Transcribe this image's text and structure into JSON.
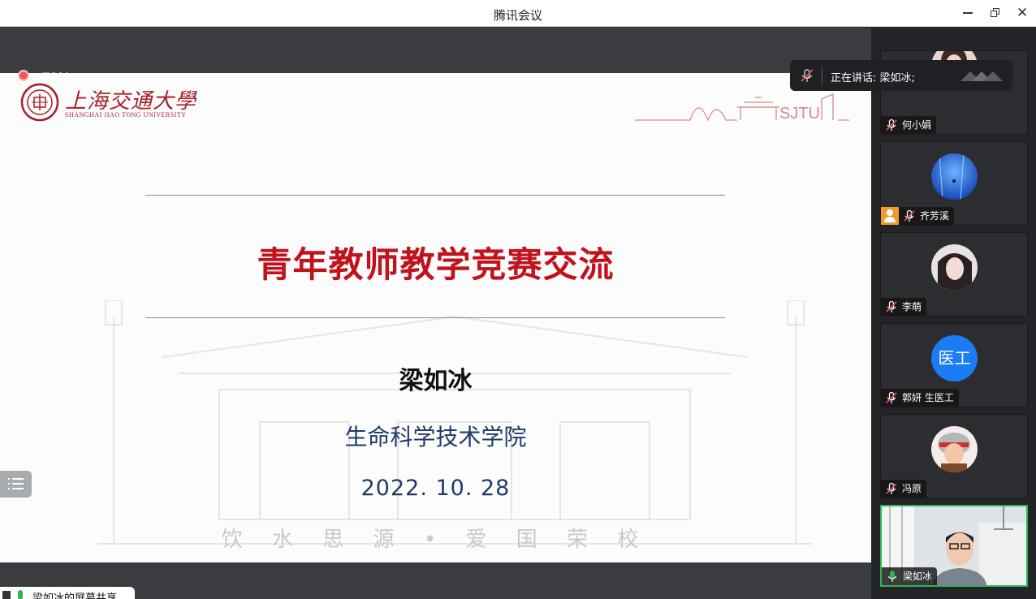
{
  "window": {
    "title": "腾讯会议"
  },
  "recording": {
    "label": "录制中"
  },
  "slide": {
    "university_cn": "上海交通大學",
    "university_en": "SHANGHAI JIAO TONG UNIVERSITY",
    "deco_text": "SJTU",
    "title": "青年教师教学竞赛交流",
    "presenter": "梁如冰",
    "school": "生命科学技术学院",
    "date": "2022. 10. 28",
    "motto": "饮 水 思 源 • 爱 国 荣 校"
  },
  "speaking_banner": {
    "text": "正在讲话: 梁如冰;"
  },
  "share_chip": {
    "text": "梁如冰的屏幕共享"
  },
  "participants": [
    {
      "name": "何小娟",
      "avatar": "photo",
      "mic": "muted"
    },
    {
      "name": "齐芳溪",
      "avatar": "blue-abstract",
      "mic": "muted",
      "badge": "person-icon"
    },
    {
      "name": "李萌",
      "avatar": "anime-portrait",
      "mic": "muted"
    },
    {
      "name": "郭妍 生医工",
      "avatar": "text",
      "avatar_text": "医工",
      "mic": "muted"
    },
    {
      "name": "冯原",
      "avatar": "cartoon",
      "mic": "muted"
    },
    {
      "name": "梁如冰",
      "avatar": "video",
      "mic": "active"
    }
  ],
  "colors": {
    "title_red": "#c0131c",
    "navy": "#1f3a6a",
    "active_green": "#2fb453",
    "avatar_blue": "#1b7cf3"
  }
}
